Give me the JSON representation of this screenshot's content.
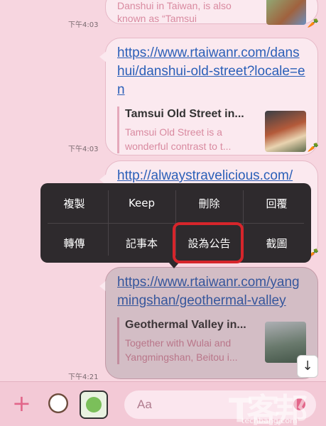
{
  "messages": [
    {
      "partial_text": "Danshui in Taiwan, is also known as “Tamsui",
      "time": "下午4:03"
    },
    {
      "link": "https://www.rtaiwanr.com/danshui/danshui-old-street?locale=en",
      "preview_title": "Tamsui Old Street in...",
      "preview_desc": "Tamsui Old Street is a wonderful contrast to t...",
      "time": "下午4:03"
    },
    {
      "link": "http://alwaystravelicious.com/"
    },
    {
      "link": "https://www.rtaiwanr.com/yangmingshan/geothermal-valley",
      "preview_title": "Geothermal Valley in...",
      "preview_desc": "Together with Wulai and Yangmingshan, Beitou i...",
      "time": "下午4:21"
    }
  ],
  "context_menu": {
    "row1": [
      "複製",
      "Keep",
      "刪除",
      "回覆"
    ],
    "row2": [
      "轉傳",
      "記事本",
      "設為公告",
      "截圖"
    ]
  },
  "input": {
    "placeholder": "Aa"
  },
  "colors": {
    "highlight": "#d6252b",
    "link": "#2a5fb8"
  }
}
